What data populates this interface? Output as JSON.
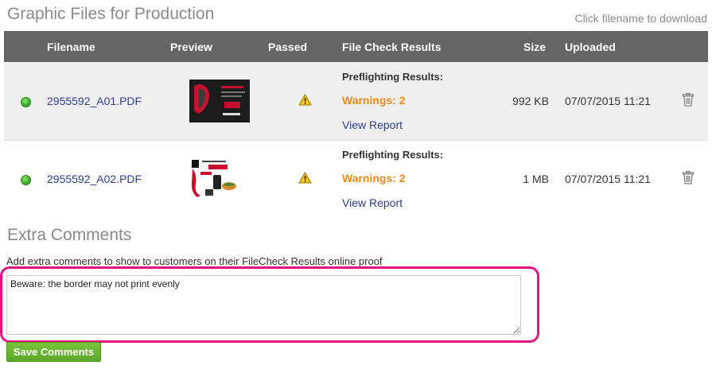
{
  "page": {
    "title": "Graphic Files for Production",
    "hint": "Click filename to download"
  },
  "table": {
    "headers": {
      "filename": "Filename",
      "preview": "Preview",
      "passed": "Passed",
      "file_check": "File Check Results",
      "size": "Size",
      "uploaded": "Uploaded"
    },
    "rows": [
      {
        "filename": "2955592_A01.PDF",
        "preflight_label": "Preflighting Results:",
        "warnings": "Warnings: 2",
        "report_link": "View Report",
        "size": "992 KB",
        "uploaded": "07/07/2015 11:21"
      },
      {
        "filename": "2955592_A02.PDF",
        "preflight_label": "Preflighting Results:",
        "warnings": "Warnings: 2",
        "report_link": "View Report",
        "size": "1 MB",
        "uploaded": "07/07/2015 11:21"
      }
    ]
  },
  "comments": {
    "title": "Extra Comments",
    "description": "Add extra comments to show to customers on their FileCheck Results online proof",
    "value": "Beware: the border may not print evenly",
    "save_label": "Save Comments"
  },
  "icons": {
    "status": "green-status-dot-icon",
    "passed": "warning-triangle-icon",
    "delete": "trash-icon"
  },
  "colors": {
    "header_bg": "#646464",
    "warning": "#e98b1b",
    "link": "#2c3e8c",
    "save_button": "#6bb632",
    "highlight": "#e5157f"
  }
}
